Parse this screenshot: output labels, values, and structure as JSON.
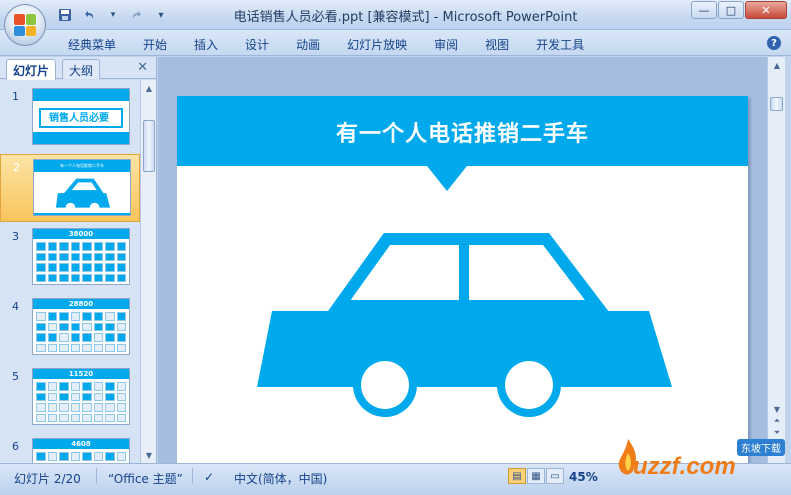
{
  "window": {
    "title": "电话销售人员必看.ppt [兼容模式] - Microsoft PowerPoint",
    "controls": {
      "minimize": "—",
      "maximize": "□",
      "close": "✕"
    }
  },
  "quick_access": [
    {
      "icon": "save-icon",
      "glyph": "💾"
    },
    {
      "icon": "undo-icon",
      "glyph": "↶"
    },
    {
      "icon": "redo-icon",
      "glyph": "↷"
    },
    {
      "icon": "customize-icon",
      "glyph": "▾"
    }
  ],
  "ribbon": {
    "tabs": [
      "经典菜单",
      "开始",
      "插入",
      "设计",
      "动画",
      "幻灯片放映",
      "审阅",
      "视图",
      "开发工具"
    ],
    "help_glyph": "?"
  },
  "left_pane": {
    "tabs": {
      "slides": "幻灯片",
      "outline": "大纲"
    },
    "close_glyph": "✕",
    "thumbnails": [
      {
        "num": "1",
        "caption": "销售人员必要",
        "selected": false
      },
      {
        "num": "2",
        "caption": "有一个人电话推销二手车",
        "selected": true
      },
      {
        "num": "3",
        "caption": "38000",
        "selected": false
      },
      {
        "num": "4",
        "caption": "28800",
        "selected": false
      },
      {
        "num": "5",
        "caption": "11520",
        "selected": false
      },
      {
        "num": "6",
        "caption": "4608",
        "selected": false
      }
    ]
  },
  "slide": {
    "title": "有一个人电话推销二手车",
    "accent_color": "#00a9ec"
  },
  "status": {
    "slide_counter": "幻灯片 2/20",
    "theme": "“Office 主题”",
    "language": "中文(简体，中国)",
    "zoom": "45%"
  },
  "watermark": {
    "text": "uzzf.com",
    "label": "东坡下载"
  }
}
